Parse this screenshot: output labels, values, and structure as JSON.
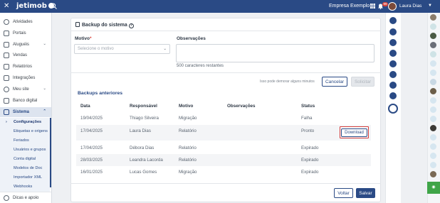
{
  "topbar": {
    "logo": "jetimob",
    "company": "Empresa Exemplo",
    "notifications": "99",
    "user_name": "Laura Dias"
  },
  "sidebar": {
    "items": [
      {
        "label": "Atividades",
        "icon": "check-circle-icon"
      },
      {
        "label": "Portais",
        "icon": "portal-icon"
      },
      {
        "label": "Aluguéis",
        "icon": "key-icon"
      },
      {
        "label": "Vendas",
        "icon": "tag-icon"
      },
      {
        "label": "Relatórios",
        "icon": "report-icon"
      },
      {
        "label": "Integrações",
        "icon": "plug-icon"
      },
      {
        "label": "Meu site",
        "icon": "globe-icon"
      },
      {
        "label": "Banco digital",
        "icon": "bank-icon"
      },
      {
        "label": "Sistema",
        "icon": "monitor-icon"
      }
    ],
    "sub_items": [
      "Configurações",
      "Etiquetas e origens",
      "Feriados",
      "Usuários e grupos",
      "Conta digital",
      "Modelos de Doc",
      "Importador XML",
      "Webhooks"
    ],
    "help": "Dicas e apoio"
  },
  "backup": {
    "title": "Backup do sistema",
    "motivo_label": "Motivo",
    "motivo_required": "*",
    "motivo_placeholder": "Selecione o motivo",
    "obs_label": "Observações",
    "chars_remaining": "500 caracteres restantes",
    "hint": "Isso pode demorar alguns minutos",
    "cancel": "Cancelar",
    "request": "Solicitar"
  },
  "previous": {
    "title": "Backups anteriores",
    "columns": [
      "Data",
      "Responsável",
      "Motivo",
      "Observações",
      "Status"
    ],
    "rows": [
      {
        "date": "19/04/2025",
        "person": "Thiago Silveira",
        "reason": "Migração",
        "obs": "",
        "status": "Falha"
      },
      {
        "date": "17/04/2025",
        "person": "Laura Dias",
        "reason": "Relatório",
        "obs": "",
        "status": "Pronto",
        "action": "Download"
      },
      {
        "date": "17/04/2025",
        "person": "Débora Dias",
        "reason": "Relatório",
        "obs": "",
        "status": "Expirado"
      },
      {
        "date": "28/03/2025",
        "person": "Leandra Lacorda",
        "reason": "Relatório",
        "obs": "",
        "status": "Expirado"
      },
      {
        "date": "16/01/2025",
        "person": "Lucas Gomes",
        "reason": "Migração",
        "obs": "",
        "status": "Expirado"
      }
    ]
  },
  "footer": {
    "back": "Voltar",
    "save": "Salvar"
  }
}
